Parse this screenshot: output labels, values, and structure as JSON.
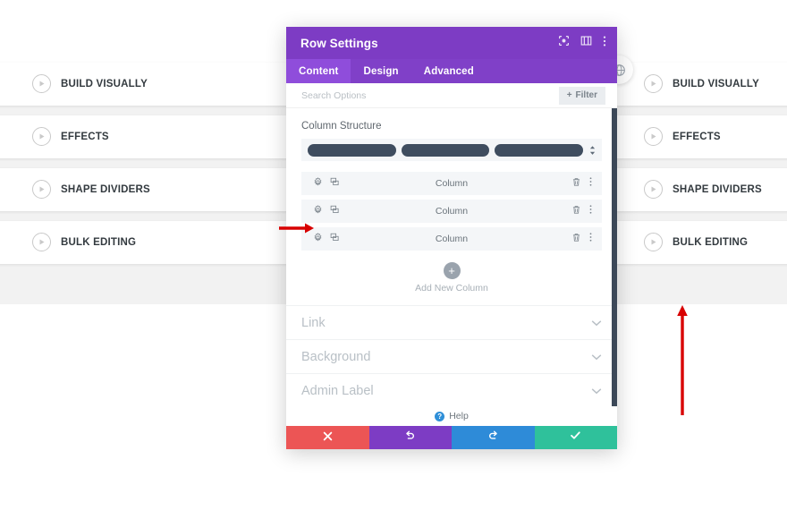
{
  "background_page": {
    "left_column_items": [
      {
        "label": "BUILD VISUALLY",
        "icon": "play-circle-icon"
      },
      {
        "label": "EFFECTS",
        "icon": "play-circle-icon"
      },
      {
        "label": "SHAPE DIVIDERS",
        "icon": "play-circle-icon"
      },
      {
        "label": "BULK EDITING",
        "icon": "play-circle-icon"
      }
    ],
    "right_column_items": [
      {
        "label": "BUILD VISUALLY",
        "icon": "play-circle-icon"
      },
      {
        "label": "EFFECTS",
        "icon": "play-circle-icon"
      },
      {
        "label": "SHAPE DIVIDERS",
        "icon": "play-circle-icon"
      },
      {
        "label": "BULK EDITING",
        "icon": "play-circle-icon"
      }
    ],
    "badge_icon": "globe-icon"
  },
  "modal": {
    "title": "Row Settings",
    "title_icons": [
      {
        "name": "target-focus-icon"
      },
      {
        "name": "layout-panel-icon"
      },
      {
        "name": "more-vertical-icon"
      }
    ],
    "tabs": [
      {
        "label": "Content",
        "active": true
      },
      {
        "label": "Design",
        "active": false
      },
      {
        "label": "Advanced",
        "active": false
      }
    ],
    "search": {
      "placeholder": "Search Options",
      "value": "",
      "filter_label": "Filter",
      "filter_icon": "plus-icon"
    },
    "column_structure": {
      "section_label": "Column Structure",
      "bars": 3,
      "stepper_icon": "updown-stepper-icon"
    },
    "columns": [
      {
        "name": "Column",
        "gear_icon": "gear-icon",
        "duplicate_icon": "duplicate-icon",
        "delete_icon": "trash-icon",
        "more_icon": "more-vertical-icon"
      },
      {
        "name": "Column",
        "gear_icon": "gear-icon",
        "duplicate_icon": "duplicate-icon",
        "delete_icon": "trash-icon",
        "more_icon": "more-vertical-icon"
      },
      {
        "name": "Column",
        "gear_icon": "gear-icon",
        "duplicate_icon": "duplicate-icon",
        "delete_icon": "trash-icon",
        "more_icon": "more-vertical-icon"
      }
    ],
    "add_column": {
      "label": "Add New Column",
      "icon": "plus-icon"
    },
    "accordions": [
      {
        "label": "Link",
        "chevron": "chevron-down-icon"
      },
      {
        "label": "Background",
        "chevron": "chevron-down-icon"
      },
      {
        "label": "Admin Label",
        "chevron": "chevron-down-icon"
      }
    ],
    "help": {
      "label": "Help",
      "badge": "?",
      "icon": "question-circle-icon"
    },
    "footer_buttons": [
      {
        "name": "discard-button",
        "icon": "close-x-icon",
        "color": "#ec5555"
      },
      {
        "name": "undo-button",
        "icon": "undo-arrow-icon",
        "color": "#7d3cc4"
      },
      {
        "name": "redo-button",
        "icon": "redo-arrow-icon",
        "color": "#2e8bd8"
      },
      {
        "name": "save-button",
        "icon": "check-icon",
        "color": "#2fc19b"
      }
    ]
  },
  "annotations": {
    "arrow_color": "#d80000",
    "horizontal_arrow": "points-right-at-third-column-gear",
    "vertical_arrow": "points-up"
  },
  "colors": {
    "titlebar": "#7d3cc4",
    "tabbar": "#8040c8",
    "tab_active": "#8f4ddb",
    "page_bg": "#f2f2f2",
    "row_bg": "#f4f6f8",
    "struct_bar": "#3f4d5f",
    "scrollbar": "#3c4858"
  }
}
